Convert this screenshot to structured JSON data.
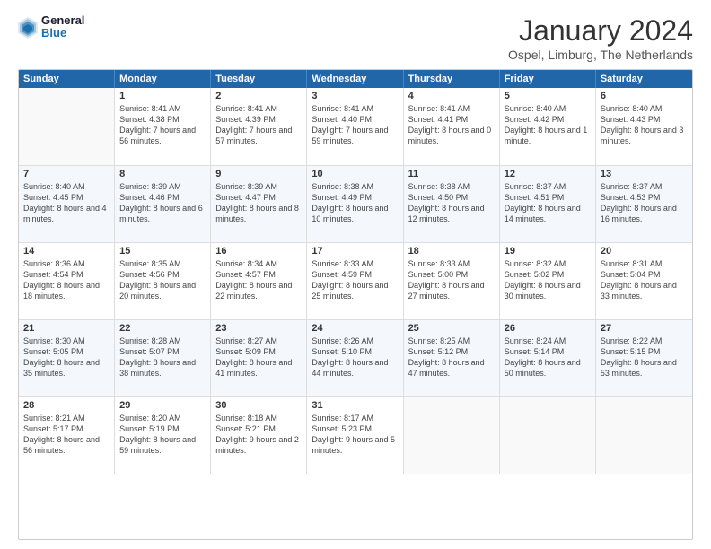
{
  "header": {
    "logo": {
      "line1": "General",
      "line2": "Blue"
    },
    "title": "January 2024",
    "location": "Ospel, Limburg, The Netherlands"
  },
  "weekdays": [
    "Sunday",
    "Monday",
    "Tuesday",
    "Wednesday",
    "Thursday",
    "Friday",
    "Saturday"
  ],
  "weeks": [
    [
      {
        "day": "",
        "sunrise": "",
        "sunset": "",
        "daylight": ""
      },
      {
        "day": "1",
        "sunrise": "Sunrise: 8:41 AM",
        "sunset": "Sunset: 4:38 PM",
        "daylight": "Daylight: 7 hours and 56 minutes."
      },
      {
        "day": "2",
        "sunrise": "Sunrise: 8:41 AM",
        "sunset": "Sunset: 4:39 PM",
        "daylight": "Daylight: 7 hours and 57 minutes."
      },
      {
        "day": "3",
        "sunrise": "Sunrise: 8:41 AM",
        "sunset": "Sunset: 4:40 PM",
        "daylight": "Daylight: 7 hours and 59 minutes."
      },
      {
        "day": "4",
        "sunrise": "Sunrise: 8:41 AM",
        "sunset": "Sunset: 4:41 PM",
        "daylight": "Daylight: 8 hours and 0 minutes."
      },
      {
        "day": "5",
        "sunrise": "Sunrise: 8:40 AM",
        "sunset": "Sunset: 4:42 PM",
        "daylight": "Daylight: 8 hours and 1 minute."
      },
      {
        "day": "6",
        "sunrise": "Sunrise: 8:40 AM",
        "sunset": "Sunset: 4:43 PM",
        "daylight": "Daylight: 8 hours and 3 minutes."
      }
    ],
    [
      {
        "day": "7",
        "sunrise": "Sunrise: 8:40 AM",
        "sunset": "Sunset: 4:45 PM",
        "daylight": "Daylight: 8 hours and 4 minutes."
      },
      {
        "day": "8",
        "sunrise": "Sunrise: 8:39 AM",
        "sunset": "Sunset: 4:46 PM",
        "daylight": "Daylight: 8 hours and 6 minutes."
      },
      {
        "day": "9",
        "sunrise": "Sunrise: 8:39 AM",
        "sunset": "Sunset: 4:47 PM",
        "daylight": "Daylight: 8 hours and 8 minutes."
      },
      {
        "day": "10",
        "sunrise": "Sunrise: 8:38 AM",
        "sunset": "Sunset: 4:49 PM",
        "daylight": "Daylight: 8 hours and 10 minutes."
      },
      {
        "day": "11",
        "sunrise": "Sunrise: 8:38 AM",
        "sunset": "Sunset: 4:50 PM",
        "daylight": "Daylight: 8 hours and 12 minutes."
      },
      {
        "day": "12",
        "sunrise": "Sunrise: 8:37 AM",
        "sunset": "Sunset: 4:51 PM",
        "daylight": "Daylight: 8 hours and 14 minutes."
      },
      {
        "day": "13",
        "sunrise": "Sunrise: 8:37 AM",
        "sunset": "Sunset: 4:53 PM",
        "daylight": "Daylight: 8 hours and 16 minutes."
      }
    ],
    [
      {
        "day": "14",
        "sunrise": "Sunrise: 8:36 AM",
        "sunset": "Sunset: 4:54 PM",
        "daylight": "Daylight: 8 hours and 18 minutes."
      },
      {
        "day": "15",
        "sunrise": "Sunrise: 8:35 AM",
        "sunset": "Sunset: 4:56 PM",
        "daylight": "Daylight: 8 hours and 20 minutes."
      },
      {
        "day": "16",
        "sunrise": "Sunrise: 8:34 AM",
        "sunset": "Sunset: 4:57 PM",
        "daylight": "Daylight: 8 hours and 22 minutes."
      },
      {
        "day": "17",
        "sunrise": "Sunrise: 8:33 AM",
        "sunset": "Sunset: 4:59 PM",
        "daylight": "Daylight: 8 hours and 25 minutes."
      },
      {
        "day": "18",
        "sunrise": "Sunrise: 8:33 AM",
        "sunset": "Sunset: 5:00 PM",
        "daylight": "Daylight: 8 hours and 27 minutes."
      },
      {
        "day": "19",
        "sunrise": "Sunrise: 8:32 AM",
        "sunset": "Sunset: 5:02 PM",
        "daylight": "Daylight: 8 hours and 30 minutes."
      },
      {
        "day": "20",
        "sunrise": "Sunrise: 8:31 AM",
        "sunset": "Sunset: 5:04 PM",
        "daylight": "Daylight: 8 hours and 33 minutes."
      }
    ],
    [
      {
        "day": "21",
        "sunrise": "Sunrise: 8:30 AM",
        "sunset": "Sunset: 5:05 PM",
        "daylight": "Daylight: 8 hours and 35 minutes."
      },
      {
        "day": "22",
        "sunrise": "Sunrise: 8:28 AM",
        "sunset": "Sunset: 5:07 PM",
        "daylight": "Daylight: 8 hours and 38 minutes."
      },
      {
        "day": "23",
        "sunrise": "Sunrise: 8:27 AM",
        "sunset": "Sunset: 5:09 PM",
        "daylight": "Daylight: 8 hours and 41 minutes."
      },
      {
        "day": "24",
        "sunrise": "Sunrise: 8:26 AM",
        "sunset": "Sunset: 5:10 PM",
        "daylight": "Daylight: 8 hours and 44 minutes."
      },
      {
        "day": "25",
        "sunrise": "Sunrise: 8:25 AM",
        "sunset": "Sunset: 5:12 PM",
        "daylight": "Daylight: 8 hours and 47 minutes."
      },
      {
        "day": "26",
        "sunrise": "Sunrise: 8:24 AM",
        "sunset": "Sunset: 5:14 PM",
        "daylight": "Daylight: 8 hours and 50 minutes."
      },
      {
        "day": "27",
        "sunrise": "Sunrise: 8:22 AM",
        "sunset": "Sunset: 5:15 PM",
        "daylight": "Daylight: 8 hours and 53 minutes."
      }
    ],
    [
      {
        "day": "28",
        "sunrise": "Sunrise: 8:21 AM",
        "sunset": "Sunset: 5:17 PM",
        "daylight": "Daylight: 8 hours and 56 minutes."
      },
      {
        "day": "29",
        "sunrise": "Sunrise: 8:20 AM",
        "sunset": "Sunset: 5:19 PM",
        "daylight": "Daylight: 8 hours and 59 minutes."
      },
      {
        "day": "30",
        "sunrise": "Sunrise: 8:18 AM",
        "sunset": "Sunset: 5:21 PM",
        "daylight": "Daylight: 9 hours and 2 minutes."
      },
      {
        "day": "31",
        "sunrise": "Sunrise: 8:17 AM",
        "sunset": "Sunset: 5:23 PM",
        "daylight": "Daylight: 9 hours and 5 minutes."
      },
      {
        "day": "",
        "sunrise": "",
        "sunset": "",
        "daylight": ""
      },
      {
        "day": "",
        "sunrise": "",
        "sunset": "",
        "daylight": ""
      },
      {
        "day": "",
        "sunrise": "",
        "sunset": "",
        "daylight": ""
      }
    ]
  ]
}
